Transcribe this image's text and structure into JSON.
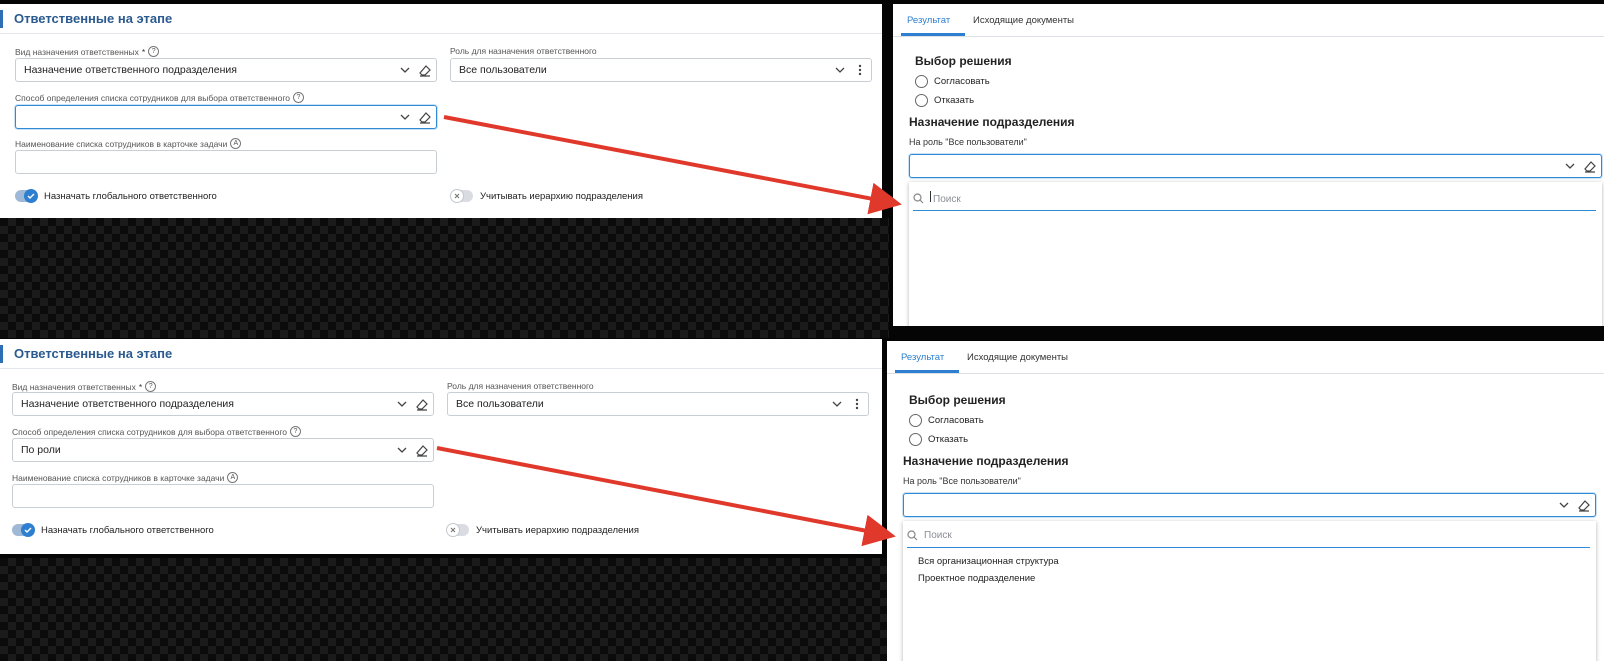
{
  "before": {
    "section_title": "Ответственные на этапе",
    "assign_type": {
      "label": "Вид назначения ответственных",
      "required_mark": "*",
      "value": "Назначение ответственного подразделения"
    },
    "role": {
      "label": "Роль для назначения ответственного",
      "value": "Все пользователи"
    },
    "method": {
      "label": "Способ определения списка сотрудников для выбора ответственного",
      "value": ""
    },
    "list_name": {
      "label": "Наименование списка сотрудников в карточке задачи",
      "value": ""
    },
    "toggle_global": {
      "label": "Назначать глобального ответственного",
      "state": "on"
    },
    "toggle_hierarchy": {
      "label": "Учитывать иерархию подразделения",
      "state": "off"
    },
    "tabs": [
      "Результат",
      "Исходящие документы"
    ],
    "decision_title": "Выбор решения",
    "options": [
      "Согласовать",
      "Отказать"
    ],
    "dept_title": "Назначение подразделения",
    "role_caption": "На роль \"Все пользователи\"",
    "dropdown_value": "",
    "search_placeholder": "Поиск",
    "dropdown_items": []
  },
  "after": {
    "section_title": "Ответственные на этапе",
    "assign_type": {
      "label": "Вид назначения ответственных",
      "required_mark": "*",
      "value": "Назначение ответственного подразделения"
    },
    "role": {
      "label": "Роль для назначения ответственного",
      "value": "Все пользователи"
    },
    "method": {
      "label": "Способ определения списка сотрудников для выбора ответственного",
      "value": "По роли"
    },
    "list_name": {
      "label": "Наименование списка сотрудников в карточке задачи",
      "value": ""
    },
    "toggle_global": {
      "label": "Назначать глобального ответственного",
      "state": "on"
    },
    "toggle_hierarchy": {
      "label": "Учитывать иерархию подразделения",
      "state": "off"
    },
    "tabs": [
      "Результат",
      "Исходящие документы"
    ],
    "decision_title": "Выбор решения",
    "options": [
      "Согласовать",
      "Отказать"
    ],
    "dept_title": "Назначение подразделения",
    "role_caption": "На роль \"Все пользователи\"",
    "dropdown_value": "",
    "search_placeholder": "Поиск",
    "dropdown_items": [
      "Вся организационная структура",
      "Проектное подразделение"
    ]
  },
  "colors": {
    "accent": "#2f7fd1",
    "arrow": "#e0392b",
    "title": "#2b5a8f"
  }
}
